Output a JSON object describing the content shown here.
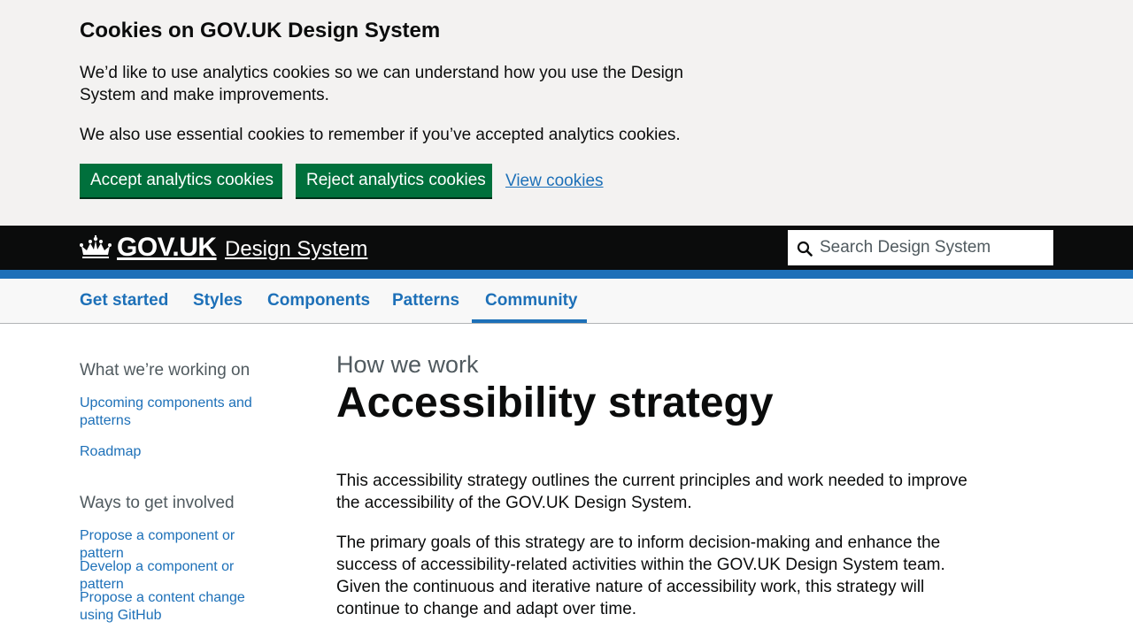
{
  "cookie_banner": {
    "title": "Cookies on GOV.UK Design System",
    "paragraph1": "We’d like to use analytics cookies so we can understand how you use the Design System and make improvements.",
    "paragraph2": "We also use essential cookies to remember if you’ve accepted analytics cookies.",
    "accept_label": "Accept analytics cookies",
    "reject_label": "Reject analytics cookies",
    "view_label": "View cookies"
  },
  "header": {
    "logo_text": "GOV.UK",
    "service_name": "Design System",
    "search_placeholder": "Search Design System"
  },
  "nav": {
    "items": [
      {
        "label": "Get started"
      },
      {
        "label": "Styles"
      },
      {
        "label": "Components"
      },
      {
        "label": "Patterns"
      },
      {
        "label": "Community"
      }
    ],
    "active": "Community"
  },
  "sidebar": {
    "sections": [
      {
        "heading": "What we’re working on",
        "links": [
          "Upcoming components and patterns",
          "Roadmap"
        ]
      },
      {
        "heading": "Ways to get involved",
        "links": [
          "Propose a component or pattern",
          "Develop a component or pattern",
          "Propose a content change using GitHub"
        ]
      }
    ]
  },
  "main": {
    "caption": "How we work",
    "title": "Accessibility strategy",
    "paragraphs": [
      "This accessibility strategy outlines the current principles and work needed to improve the accessibility of the GOV.UK Design System.",
      "The primary goals of this strategy are to inform decision-making and enhance the success of accessibility-related activities within the GOV.UK Design System team. Given the continuous and iterative nature of accessibility work, this strategy will continue to change and adapt over time."
    ]
  },
  "colors": {
    "brand_blue": "#1d70b8",
    "button_green": "#00703c",
    "header_black": "#0b0c0c",
    "banner_grey": "#f3f2f1"
  }
}
